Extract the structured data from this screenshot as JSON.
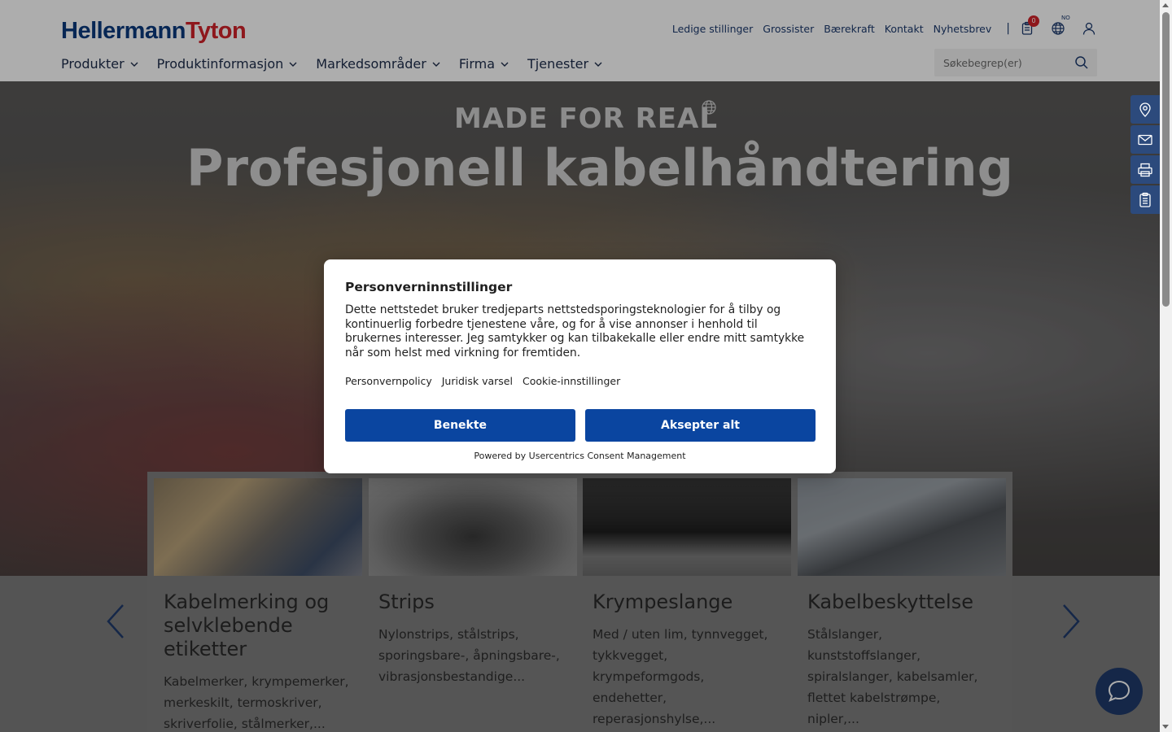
{
  "brand": {
    "part1": "Hellermann",
    "part2": "Tyton"
  },
  "top_nav": {
    "links": [
      "Ledige stillinger",
      "Grossister",
      "Bærekraft",
      "Kontakt",
      "Nyhetsbrev"
    ],
    "separator": "|",
    "cart_count": "0",
    "language": "NO",
    "icons": [
      "clipboard-icon",
      "globe-icon",
      "user-icon"
    ]
  },
  "main_nav": {
    "items": [
      "Produkter",
      "Produktinformasjon",
      "Markedsområder",
      "Firma",
      "Tjenester"
    ]
  },
  "search": {
    "placeholder": "Søkebegrep(er)",
    "value": ""
  },
  "hero": {
    "kicker": "MADE FOR REAL",
    "title": "Profesjonell kabelhåndtering"
  },
  "side_tools": [
    "location-pin-icon",
    "mail-icon",
    "printer-icon",
    "clipboard-icon"
  ],
  "cards": [
    {
      "title": "Kabelmerking og selvklebende etiketter",
      "description": "Kabelmerker, krympemerker, merkeskilt, termoskriver, skriverfolie, stålmerker,..."
    },
    {
      "title": "Strips",
      "description": "Nylonstrips, stålstrips, sporingsbare-, åpningsbare-, vibrasjonsbestandige..."
    },
    {
      "title": "Krympeslange",
      "description": "Med / uten lim, tynnvegget, tykkvegget, krympeformgods, endehetter, reperasjonshylse,..."
    },
    {
      "title": "Kabelbeskyttelse",
      "description": "Stålslanger, kunststoffslanger, spiralslanger, kabelsamler, flettet kabelstrømpe, nipler,..."
    }
  ],
  "consent": {
    "title": "Personverninnstillinger",
    "body": "Dette nettstedet bruker tredjeparts nettstedsporingsteknologier for å tilby og kontinuerlig forbedre tjenestene våre, og for å vise annonser i henhold til brukernes interesser. Jeg samtykker og kan tilbakekalle eller endre mitt samtykke når som helst med virkning for fremtiden.",
    "links": [
      "Personvernpolicy",
      "Juridisk varsel",
      "Cookie-innstillinger"
    ],
    "deny_label": "Benekte",
    "accept_label": "Aksepter alt",
    "powered_by": "Powered by Usercentrics Consent Management"
  },
  "colors": {
    "brand_blue": "#0b3a7e",
    "brand_red": "#d2232a",
    "button_blue": "#0a45a0",
    "side_tool_blue": "#2c4a7c"
  }
}
